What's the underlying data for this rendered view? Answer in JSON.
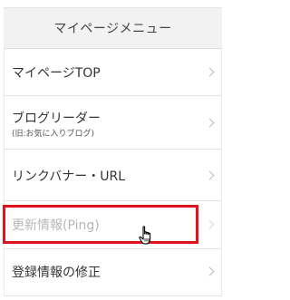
{
  "menu": {
    "title": "マイページメニュー",
    "items": [
      {
        "label": "マイページTOP",
        "sublabel": ""
      },
      {
        "label": "ブログリーダー",
        "sublabel": "(旧:お気に入りブログ)"
      },
      {
        "label": "リンクバナー・URL",
        "sublabel": ""
      },
      {
        "label": "更新情報(Ping)",
        "sublabel": "",
        "state": "disabled"
      },
      {
        "label": "登録情報の修正",
        "sublabel": ""
      }
    ]
  },
  "colors": {
    "highlight": "#e0141d",
    "header_bg": "#f2f2f2",
    "disabled_text": "#b7b7b7"
  },
  "icons": {
    "item_arrow": "chevron-right-icon",
    "pointer": "hand-pointer-cursor-icon"
  }
}
